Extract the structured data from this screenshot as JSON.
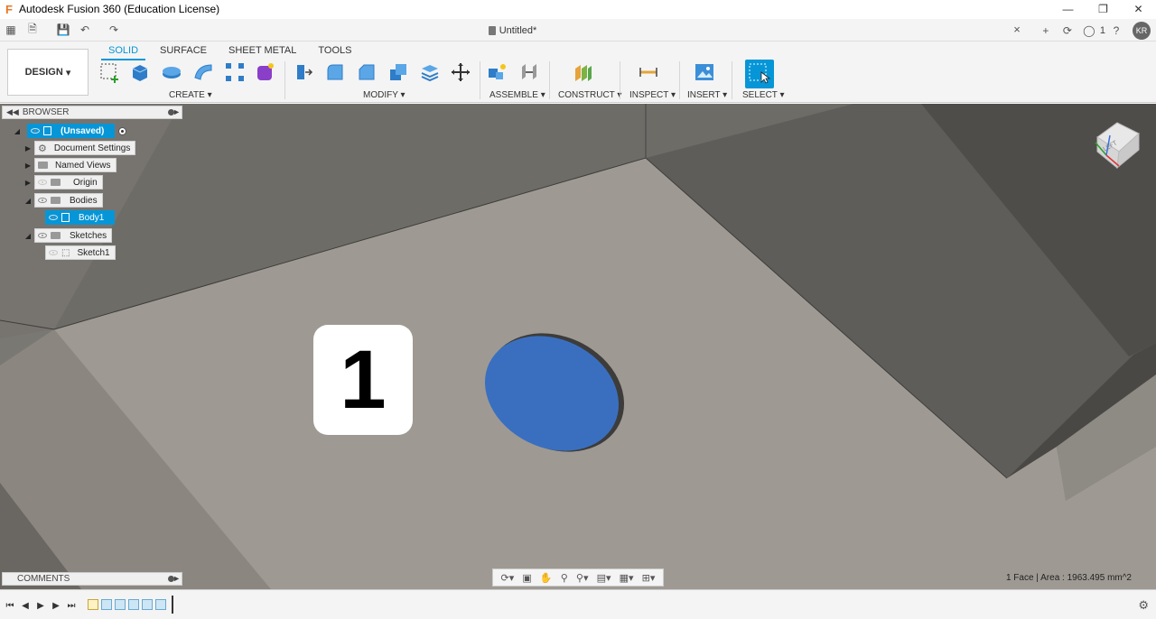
{
  "window": {
    "title": "Autodesk Fusion 360 (Education License)",
    "logo": "F"
  },
  "document": {
    "tab_title": "Untitled*",
    "job_count": "1",
    "user_initials": "KR"
  },
  "toolbar": {
    "workspace": "DESIGN",
    "tabs": [
      "SOLID",
      "SURFACE",
      "SHEET METAL",
      "TOOLS"
    ],
    "active_tab": "SOLID",
    "groups": {
      "create": "CREATE",
      "modify": "MODIFY",
      "assemble": "ASSEMBLE",
      "construct": "CONSTRUCT",
      "inspect": "INSPECT",
      "insert": "INSERT",
      "select": "SELECT"
    }
  },
  "browser": {
    "title": "BROWSER",
    "root": "(Unsaved)",
    "items": [
      {
        "label": "Document Settings"
      },
      {
        "label": "Named Views"
      },
      {
        "label": "Origin"
      },
      {
        "label": "Bodies"
      },
      {
        "label": "Body1"
      },
      {
        "label": "Sketches"
      },
      {
        "label": "Sketch1"
      }
    ]
  },
  "overlay": {
    "step_number": "1"
  },
  "comments": {
    "title": "COMMENTS"
  },
  "status": {
    "selection_info": "1 Face | Area : 1963.495 mm^2"
  },
  "colors": {
    "accent": "#0696d7",
    "selected_face": "#3a6fc0",
    "floor": "#9c9890"
  }
}
